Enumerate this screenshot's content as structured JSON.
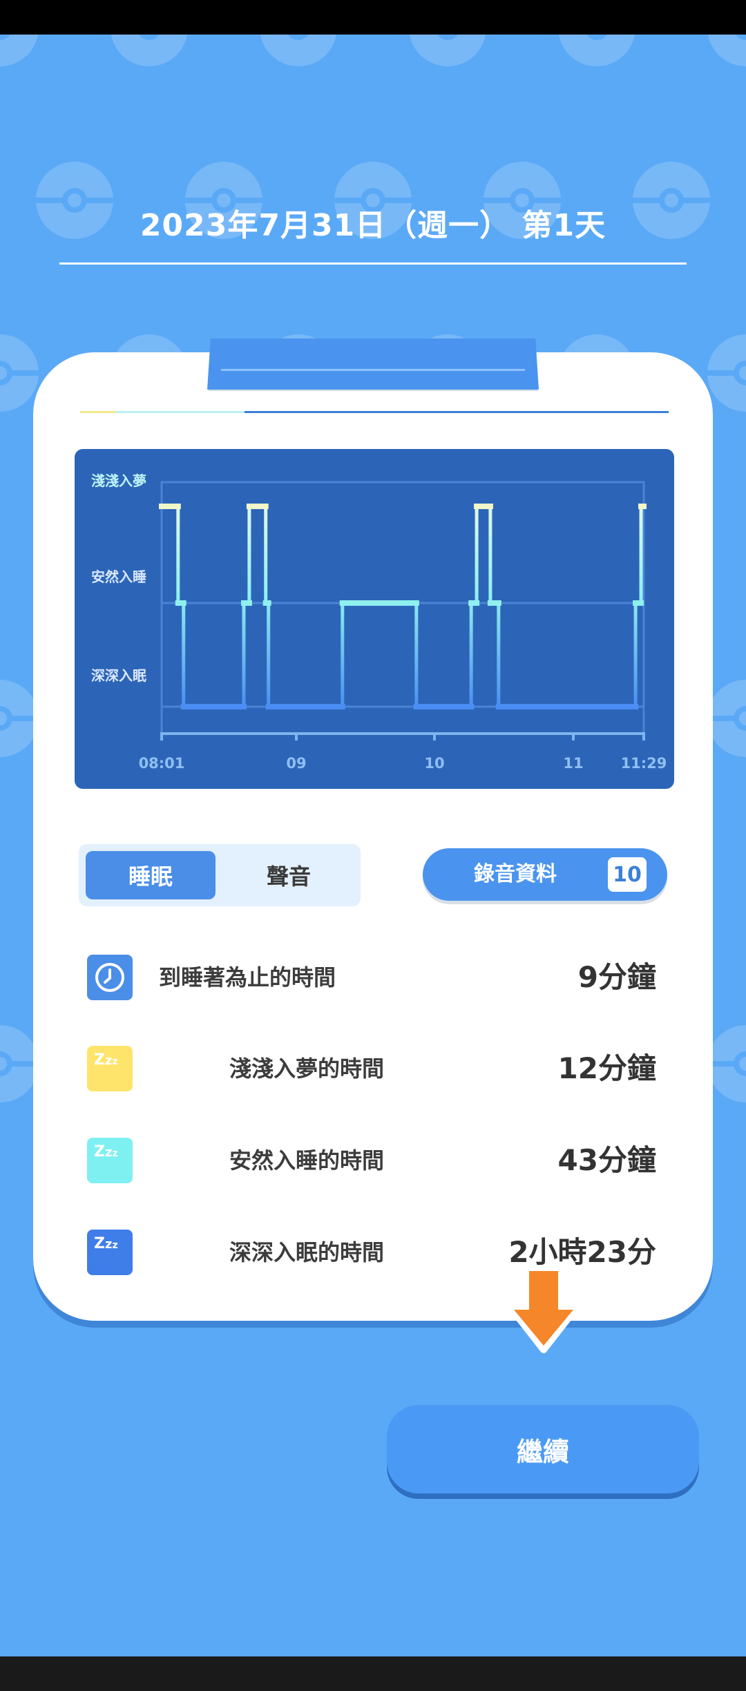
{
  "header": {
    "title": "2023年7月31日（週一） 第1天"
  },
  "chart_data": {
    "type": "line",
    "title": "",
    "y_levels": [
      "淺淺入夢",
      "安然入睡",
      "深深入眠"
    ],
    "x_ticks": [
      "08:01",
      "09",
      "10",
      "11",
      "11:29"
    ],
    "x_range_minutes": [
      0,
      88
    ],
    "series": [
      {
        "steps": [
          {
            "start": 0,
            "end": 3,
            "level": 0
          },
          {
            "start": 3,
            "end": 4,
            "level": 1
          },
          {
            "start": 4,
            "end": 15,
            "level": 2
          },
          {
            "start": 15,
            "end": 16,
            "level": 1
          },
          {
            "start": 16,
            "end": 19,
            "level": 0
          },
          {
            "start": 19,
            "end": 19.5,
            "level": 1
          },
          {
            "start": 19.5,
            "end": 33,
            "level": 2
          },
          {
            "start": 33,
            "end": 46.5,
            "level": 1
          },
          {
            "start": 46.5,
            "end": 56.5,
            "level": 2
          },
          {
            "start": 56.5,
            "end": 57.5,
            "level": 1
          },
          {
            "start": 57.5,
            "end": 60,
            "level": 0
          },
          {
            "start": 60,
            "end": 61.5,
            "level": 1
          },
          {
            "start": 61.5,
            "end": 86.5,
            "level": 2
          },
          {
            "start": 86.5,
            "end": 87.5,
            "level": 1
          },
          {
            "start": 87.5,
            "end": 88,
            "level": 0
          }
        ]
      }
    ],
    "level_colors": [
      "#f2f7c8",
      "#8ff0ee",
      "#4a8ef3"
    ]
  },
  "tabs": {
    "sleep_label": "睡眠",
    "sound_label": "聲音"
  },
  "recording": {
    "label": "錄音資料",
    "count": "10"
  },
  "stats": {
    "fall_asleep": {
      "label": "到睡著為止的時間",
      "value": "9分鐘"
    },
    "light": {
      "label": "淺淺入夢的時間",
      "value": "12分鐘",
      "icon_color": "#ffe46b"
    },
    "normal": {
      "label": "安然入睡的時間",
      "value": "43分鐘",
      "icon_color": "#7ff0f2"
    },
    "deep": {
      "label": "深深入眠的時間",
      "value": "2小時23分",
      "icon_color": "#3f7ee8"
    }
  },
  "continue_button": {
    "label": "繼續"
  },
  "colors": {
    "background": "#5aa9f6",
    "accent": "#4a94ef",
    "arrow": "#f5862a"
  }
}
